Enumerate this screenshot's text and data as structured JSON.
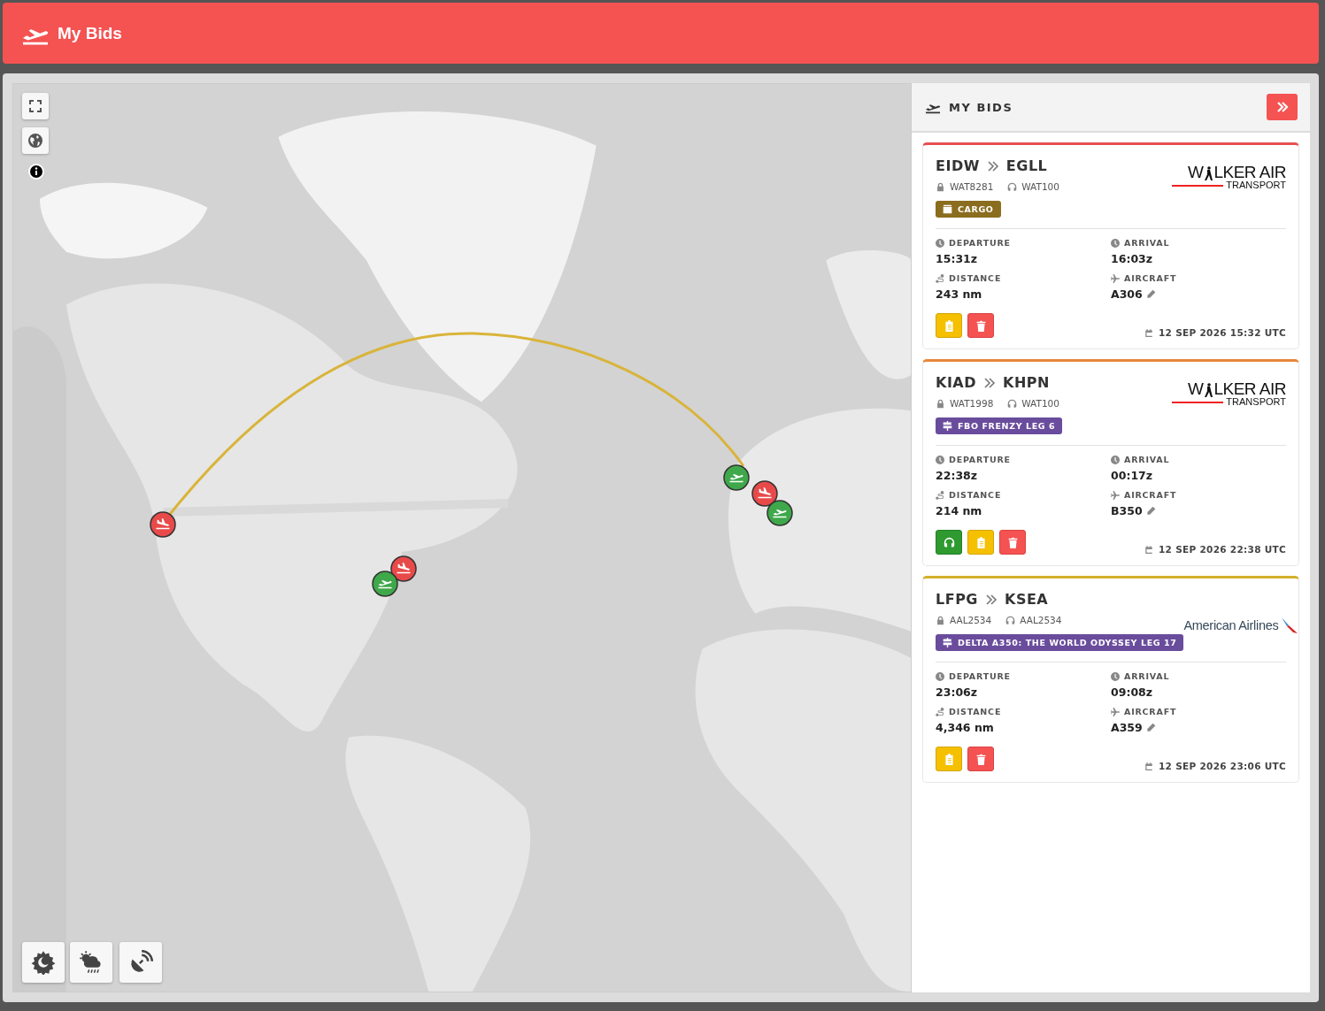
{
  "header": {
    "title": "My Bids"
  },
  "sidebar": {
    "title": "MY BIDS"
  },
  "bids": [
    {
      "color": "#e85050",
      "origin": "EIDW",
      "destination": "EGLL",
      "flight": "WAT8281",
      "callsign": "WAT100",
      "logo": {
        "kind": "walker",
        "text": "LKER AIR",
        "initial": "W",
        "subtext": "TRANSPORT"
      },
      "tag": {
        "kind": "cargo",
        "label": "CARGO",
        "color": "#8a6d1e"
      },
      "departure_label": "DEPARTURE",
      "departure": "15:31z",
      "arrival_label": "ARRIVAL",
      "arrival": "16:03z",
      "distance_label": "DISTANCE",
      "distance": "243 nm",
      "aircraft_label": "AIRCRAFT",
      "aircraft": "A306",
      "actions": [
        {
          "kind": "brief"
        },
        {
          "kind": "delete"
        }
      ],
      "date": "12 SEP 2026 15:32 UTC"
    },
    {
      "color": "#e8873a",
      "origin": "KIAD",
      "destination": "KHPN",
      "flight": "WAT1998",
      "callsign": "WAT100",
      "logo": {
        "kind": "walker",
        "text": "LKER AIR",
        "initial": "W",
        "subtext": "TRANSPORT"
      },
      "tag": {
        "kind": "tour",
        "label": "FBO FRENZY LEG 6",
        "color": "#6a4c9c"
      },
      "departure_label": "DEPARTURE",
      "departure": "22:38z",
      "arrival_label": "ARRIVAL",
      "arrival": "00:17z",
      "distance_label": "DISTANCE",
      "distance": "214 nm",
      "aircraft_label": "AIRCRAFT",
      "aircraft": "B350",
      "actions": [
        {
          "kind": "fly"
        },
        {
          "kind": "brief"
        },
        {
          "kind": "delete"
        }
      ],
      "date": "12 SEP 2026 22:38 UTC"
    },
    {
      "color": "#d4b02a",
      "origin": "LFPG",
      "destination": "KSEA",
      "flight": "AAL2534",
      "callsign": "AAL2534",
      "logo": {
        "kind": "american",
        "text": "American Airlines"
      },
      "tag": {
        "kind": "tour",
        "label": "DELTA A350: THE WORLD ODYSSEY LEG 17",
        "color": "#6a4c9c"
      },
      "departure_label": "DEPARTURE",
      "departure": "23:06z",
      "arrival_label": "ARRIVAL",
      "arrival": "09:08z",
      "distance_label": "DISTANCE",
      "distance": "4,346 nm",
      "aircraft_label": "AIRCRAFT",
      "aircraft": "A359",
      "actions": [
        {
          "kind": "brief"
        },
        {
          "kind": "delete"
        }
      ],
      "date": "12 SEP 2026 23:06 UTC"
    }
  ]
}
